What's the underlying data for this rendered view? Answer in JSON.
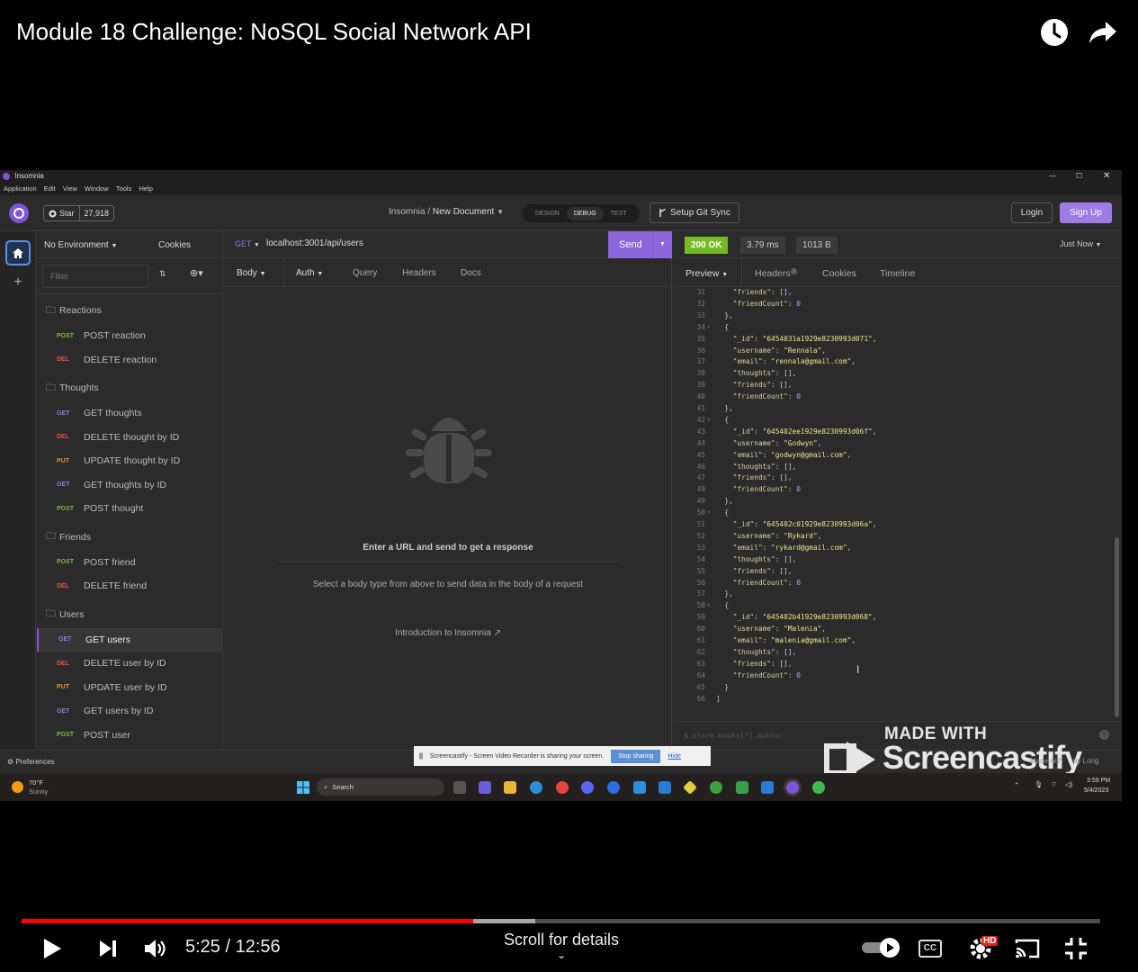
{
  "video": {
    "title": "Module 18 Challenge: NoSQL Social Network API",
    "time_current": "5:25",
    "time_total": "12:56",
    "time_display": "5:25 / 12:56",
    "progress_fraction": 0.419,
    "buffered_fraction": 0.476,
    "scroll_hint": "Scroll for details",
    "hd_badge": "HD",
    "cc_label": "CC"
  },
  "app": {
    "window_title": "Insomnia",
    "menu": [
      "Application",
      "Edit",
      "View",
      "Window",
      "Tools",
      "Help"
    ],
    "github": {
      "star_label": "Star",
      "star_count": "27,918"
    },
    "breadcrumb": {
      "root": "Insomnia",
      "sep": "/",
      "doc": "New Document"
    },
    "mode_tabs": [
      "DESIGN",
      "DEBUG",
      "TEST"
    ],
    "active_mode": "DEBUG",
    "git_sync": "Setup Git Sync",
    "login": "Login",
    "signup": "Sign Up"
  },
  "sidebar": {
    "environment": "No Environment",
    "cookies": "Cookies",
    "filter_placeholder": "Filter",
    "groups": [
      {
        "label": "Reactions",
        "items": [
          {
            "method": "POST",
            "label": "POST reaction"
          },
          {
            "method": "DEL",
            "label": "DELETE reaction"
          }
        ]
      },
      {
        "label": "Thoughts",
        "items": [
          {
            "method": "GET",
            "label": "GET thoughts"
          },
          {
            "method": "DEL",
            "label": "DELETE thought by ID"
          },
          {
            "method": "PUT",
            "label": "UPDATE thought by ID"
          },
          {
            "method": "GET",
            "label": "GET thoughts by ID"
          },
          {
            "method": "POST",
            "label": "POST thought"
          }
        ]
      },
      {
        "label": "Friends",
        "items": [
          {
            "method": "POST",
            "label": "POST friend"
          },
          {
            "method": "DEL",
            "label": "DELETE friend"
          }
        ]
      },
      {
        "label": "Users",
        "items": [
          {
            "method": "GET",
            "label": "GET users",
            "active": true
          },
          {
            "method": "DEL",
            "label": "DELETE user by ID"
          },
          {
            "method": "PUT",
            "label": "UPDATE user by ID"
          },
          {
            "method": "GET",
            "label": "GET users by ID"
          },
          {
            "method": "POST",
            "label": "POST user"
          }
        ]
      }
    ],
    "preferences": "Preferences"
  },
  "request": {
    "method": "GET",
    "url": "localhost:3001/api/users",
    "send": "Send",
    "tabs": [
      "Body",
      "Auth",
      "Query",
      "Headers",
      "Docs"
    ],
    "empty_title": "Enter a URL and send to get a response",
    "empty_body": "Select a body type from above to send data in the body of a request",
    "intro_link": "Introduction to Insomnia"
  },
  "response": {
    "status": "200 OK",
    "time": "3.79 ms",
    "size": "1013 B",
    "when": "Just Now",
    "tabs": [
      "Preview",
      "Headers",
      "Cookies",
      "Timeline"
    ],
    "headers_count": "7",
    "filter_placeholder": "$.store.books[*].author",
    "lines": [
      {
        "n": "31",
        "t": "    \"friends\": [],"
      },
      {
        "n": "32",
        "t": "    \"friendCount\": 0"
      },
      {
        "n": "33",
        "t": "  },"
      },
      {
        "n": "34",
        "t": "  {",
        "fold": true
      },
      {
        "n": "35",
        "t": "    \"_id\": \"6454031a1929e8230993d071\","
      },
      {
        "n": "36",
        "t": "    \"username\": \"Rennala\","
      },
      {
        "n": "37",
        "t": "    \"email\": \"rennala@gmail.com\","
      },
      {
        "n": "38",
        "t": "    \"thoughts\": [],"
      },
      {
        "n": "39",
        "t": "    \"friends\": [],"
      },
      {
        "n": "40",
        "t": "    \"friendCount\": 0"
      },
      {
        "n": "41",
        "t": "  },"
      },
      {
        "n": "42",
        "t": "  {",
        "fold": true
      },
      {
        "n": "43",
        "t": "    \"_id\": \"645402ee1929e8230993d06f\","
      },
      {
        "n": "44",
        "t": "    \"username\": \"Godwyn\","
      },
      {
        "n": "45",
        "t": "    \"email\": \"godwyn@gmail.com\","
      },
      {
        "n": "46",
        "t": "    \"thoughts\": [],"
      },
      {
        "n": "47",
        "t": "    \"friends\": [],"
      },
      {
        "n": "48",
        "t": "    \"friendCount\": 0"
      },
      {
        "n": "49",
        "t": "  },"
      },
      {
        "n": "50",
        "t": "  {",
        "fold": true
      },
      {
        "n": "51",
        "t": "    \"_id\": \"645402c01929e8230993d06a\","
      },
      {
        "n": "52",
        "t": "    \"username\": \"Rykard\","
      },
      {
        "n": "53",
        "t": "    \"email\": \"rykard@gmail.com\","
      },
      {
        "n": "54",
        "t": "    \"thoughts\": [],"
      },
      {
        "n": "55",
        "t": "    \"friends\": [],"
      },
      {
        "n": "56",
        "t": "    \"friendCount\": 0"
      },
      {
        "n": "57",
        "t": "  },"
      },
      {
        "n": "58",
        "t": "  {",
        "fold": true
      },
      {
        "n": "59",
        "t": "    \"_id\": \"645402b41929e8230993d068\","
      },
      {
        "n": "60",
        "t": "    \"username\": \"Malenia\","
      },
      {
        "n": "61",
        "t": "    \"email\": \"malenia@gmail.com\","
      },
      {
        "n": "62",
        "t": "    \"thoughts\": [],"
      },
      {
        "n": "63",
        "t": "    \"friends\": [],"
      },
      {
        "n": "64",
        "t": "    \"friendCount\": 0"
      },
      {
        "n": "65",
        "t": "  }"
      },
      {
        "n": "66",
        "t": "]"
      }
    ]
  },
  "screencastify": {
    "share_text": "Screencastify - Screen Video Recorder is sharing your screen.",
    "stop": "Stop sharing",
    "hide": "Hide",
    "watermark_top": "MADE WITH",
    "watermark_brand": "Screencastify",
    "made_with": "Made with",
    "by": "by Long"
  },
  "taskbar": {
    "weather_temp": "70°F",
    "weather_desc": "Sunny",
    "search": "Search",
    "time": "3:59 PM",
    "date": "5/4/2023"
  },
  "colors": {
    "accent": "#7e55d9",
    "send": "#8b67db",
    "ok": "#75ba24",
    "progress": "#ff0000",
    "get": "#8c7fe8",
    "post": "#77b94c",
    "delete": "#e4544a",
    "put": "#e88c2f"
  }
}
